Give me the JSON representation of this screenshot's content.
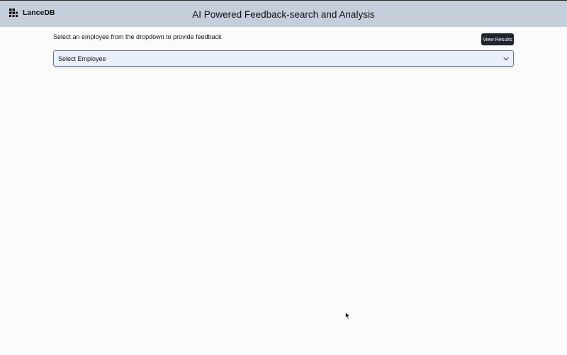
{
  "header": {
    "brand_name": "LanceDB",
    "brand_icon": "lancedb-logo-icon",
    "title": "AI Powered Feedback-search and Analysis",
    "background_color": "#c5cfdc"
  },
  "main": {
    "instruction": "Select an employee from the dropdown to provide feedback",
    "view_results_label": "View Results",
    "employee_select": {
      "value": "Select Employee",
      "icon": "chevron-down-icon"
    }
  },
  "colors": {
    "button_bg": "#1f2430",
    "select_bg": "#eaf0fb",
    "page_bg": "#fbfbfc"
  }
}
